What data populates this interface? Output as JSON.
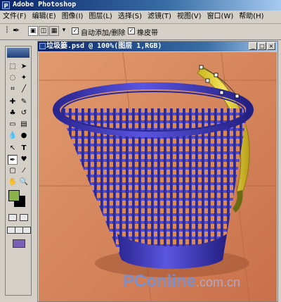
{
  "app": {
    "title": "Adobe Photoshop",
    "icon": "photoshop-icon"
  },
  "menu": {
    "items": [
      "文件(F)",
      "编辑(E)",
      "图像(I)",
      "图层(L)",
      "选择(S)",
      "滤镜(T)",
      "视图(V)",
      "窗口(W)",
      "帮助(H)"
    ]
  },
  "options": {
    "auto_add_delete": {
      "label": "自动添加/删除",
      "checked": true
    },
    "rubber_band": {
      "label": "橡皮带",
      "checked": true
    }
  },
  "document": {
    "title": "垃圾篓.psd @ 100%(图层 1,RGB)",
    "window_buttons": [
      "_",
      "□",
      "×"
    ]
  },
  "colors": {
    "foreground": "#8bb34a",
    "background": "#000000",
    "basket": "#3b37b8",
    "floor": "#d88458",
    "banana": "#e9d63a"
  },
  "watermark": {
    "main": "PConline",
    "sub": ".com.cn"
  }
}
